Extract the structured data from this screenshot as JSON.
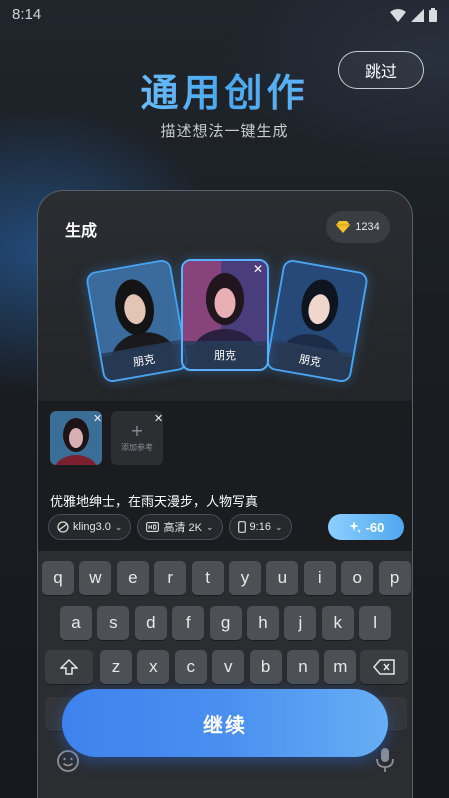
{
  "status_bar": {
    "time": "8:14"
  },
  "header": {
    "skip_label": "跳过",
    "title": "通用创作",
    "subtitle": "描述想法一键生成"
  },
  "phone": {
    "panel_title": "生成",
    "credits": "1234",
    "cards": [
      {
        "label": "朋克"
      },
      {
        "label": "朋克"
      },
      {
        "label": "朋克"
      }
    ],
    "add_reference_label": "添加参考",
    "prompt_text": "优雅地绅士，在雨天漫步，人物写真",
    "chips": {
      "model": "kling3.0",
      "quality": "高清 2K",
      "ratio": "9:16"
    },
    "generate_cost": "-60",
    "keyboard": {
      "row1": [
        "q",
        "w",
        "e",
        "r",
        "t",
        "y",
        "u",
        "i",
        "o",
        "p"
      ],
      "row2": [
        "a",
        "s",
        "d",
        "f",
        "g",
        "h",
        "j",
        "k",
        "l"
      ],
      "row3": [
        "z",
        "x",
        "c",
        "v",
        "b",
        "n",
        "m"
      ]
    }
  },
  "continue_label": "继续",
  "colors": {
    "accent": "#4a8ff0",
    "card_border": "#4aa3f0",
    "title_gradient": "#4aa8f0"
  }
}
